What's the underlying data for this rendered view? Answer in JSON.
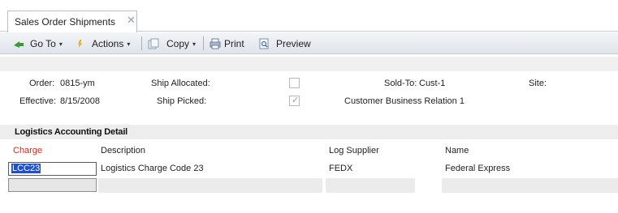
{
  "tab": {
    "title": "Sales Order Shipments",
    "close": "✕"
  },
  "toolbar": {
    "goto": "Go To",
    "actions": "Actions",
    "copy": "Copy",
    "print": "Print",
    "preview": "Preview",
    "caret": "▾"
  },
  "header": {
    "order_label": "Order:",
    "order_value": "0815-ym",
    "effective_label": "Effective:",
    "effective_value": "8/15/2008",
    "ship_allocated_label": "Ship Allocated:",
    "ship_allocated_checked": false,
    "ship_picked_label": "Ship Picked:",
    "ship_picked_checked": true,
    "sold_to_label": "Sold-To:",
    "sold_to_value": "Cust-1",
    "sold_to_name": "Customer Business Relation 1",
    "site_label": "Site:"
  },
  "section": {
    "title": "Logistics Accounting Detail"
  },
  "grid": {
    "columns": [
      "Charge",
      "Description",
      "Log Supplier",
      "Name"
    ],
    "rows": [
      {
        "charge": "LCC23",
        "description": "Logistics Charge Code 23",
        "log_supplier": "FEDX",
        "name": "Federal Express"
      }
    ]
  },
  "colors": {
    "charge_header": "#e0241b",
    "selection": "#1d4fd1"
  }
}
